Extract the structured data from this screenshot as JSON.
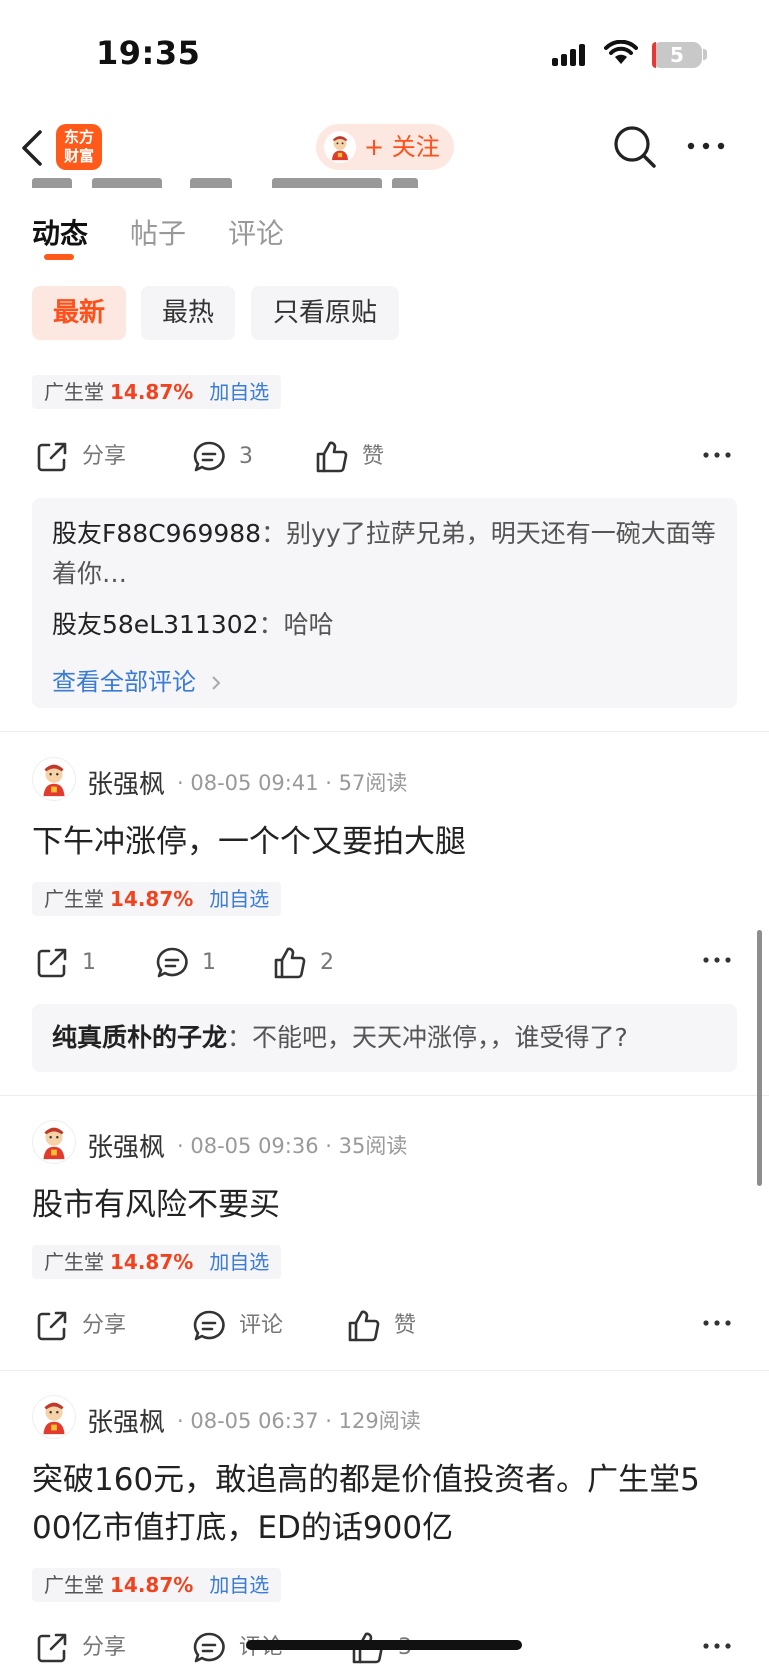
{
  "status": {
    "time": "19:35",
    "battery": "5"
  },
  "nav": {
    "logo_line1": "东方",
    "logo_line2": "财富",
    "follow": "+ 关注"
  },
  "tabs": [
    {
      "label": "动态"
    },
    {
      "label": "帖子"
    },
    {
      "label": "评论"
    }
  ],
  "filters": [
    {
      "label": "最新"
    },
    {
      "label": "最热"
    },
    {
      "label": "只看原贴"
    }
  ],
  "stock": {
    "name": "广生堂",
    "change": "14.87%",
    "add": "加自选"
  },
  "icon_colors": {
    "accent": "#ff5a1a",
    "link": "#3a7bd5",
    "rise": "#f0431f"
  },
  "post0": {
    "actions": {
      "share": "分享",
      "comment": "3",
      "like": "赞"
    },
    "comments": [
      {
        "user": "股友F88C969988",
        "sep": "：",
        "text": "别yy了拉萨兄弟，明天还有一碗大面等着你…"
      },
      {
        "user": "股友58eL311302",
        "sep": "：",
        "text": "哈哈"
      }
    ],
    "view_all": "查看全部评论"
  },
  "post1": {
    "author": "张强枫",
    "time": "08-05 09:41",
    "reads": "57阅读",
    "text": "下午冲涨停，一个个又要拍大腿",
    "actions": {
      "share": "1",
      "comment": "1",
      "like": "2"
    },
    "comments": [
      {
        "user": "纯真质朴的子龙",
        "sep": "：",
        "text": "不能吧，天天冲涨停，，谁受得了?"
      }
    ]
  },
  "post2": {
    "author": "张强枫",
    "time": "08-05 09:36",
    "reads": "35阅读",
    "text": "股市有风险不要买",
    "actions": {
      "share": "分享",
      "comment": "评论",
      "like": "赞"
    }
  },
  "post3": {
    "author": "张强枫",
    "time": "08-05 06:37",
    "reads": "129阅读",
    "text_line1": "突破160元，敢追高的都是价值投资者。广生堂5",
    "text_line2": "00亿市值打底，ED的话900亿",
    "actions": {
      "share": "分享",
      "comment": "评论",
      "like": "3"
    }
  },
  "meta_sep": "·"
}
